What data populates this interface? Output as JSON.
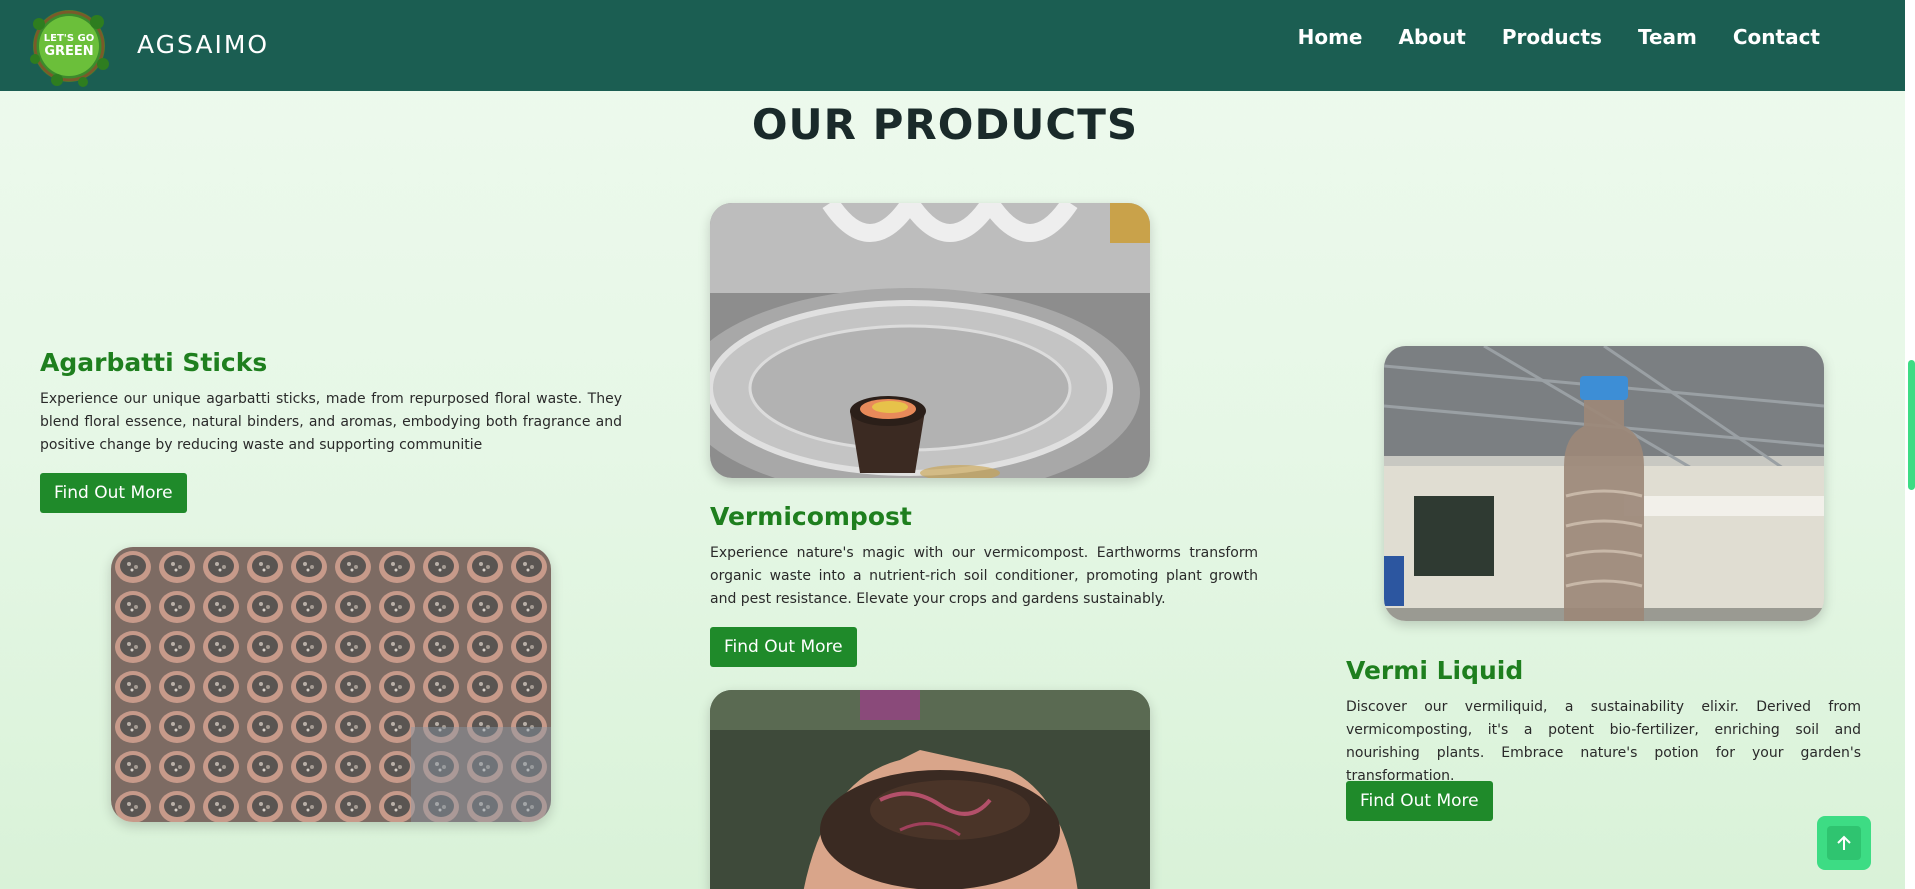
{
  "header": {
    "logo_text": "LET'S GO GREEN",
    "brand": "AGSAIMO",
    "nav": [
      "Home",
      "About",
      "Products",
      "Team",
      "Contact"
    ]
  },
  "section": {
    "title": "OUR PRODUCTS"
  },
  "products": [
    {
      "title": "Agarbatti Sticks",
      "description": "Experience our unique agarbatti sticks, made from repurposed floral waste. They blend floral essence, natural binders, and aromas, embodying both fragrance and positive change by reducing waste and supporting communitie",
      "button": "Find Out More"
    },
    {
      "title": "Vermicompost",
      "description": "Experience nature's magic with our vermicompost. Earthworms transform organic waste into a nutrient-rich soil conditioner, promoting plant growth and pest resistance. Elevate your crops and gardens sustainably.",
      "button": "Find Out More"
    },
    {
      "title": "Vermi Liquid",
      "description": "Discover our vermiliquid, a sustainability elixir. Derived from vermicomposting, it's a potent bio-fertilizer, enriching soil and nourishing plants. Embrace nature's potion for your garden's transformation.",
      "button": "Find Out More"
    }
  ],
  "colors": {
    "header_bg": "#1b5e52",
    "accent_green": "#1f8a2a",
    "title_green": "#1e7f1e",
    "scroll_top": "#3ddc84"
  },
  "icons": {
    "scroll_top": "arrow-up-icon"
  }
}
